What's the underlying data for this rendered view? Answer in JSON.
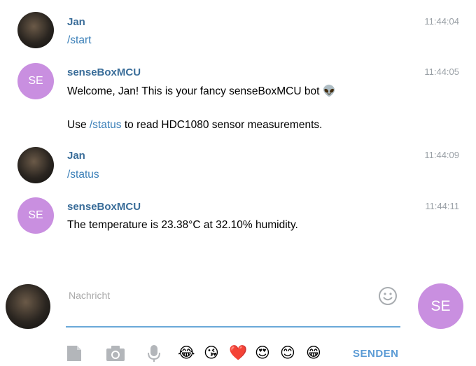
{
  "messages": [
    {
      "sender": "Jan",
      "time": "11:44:04",
      "avatar": "photo",
      "lines": [
        {
          "parts": [
            {
              "text": "/start",
              "cmd": true
            }
          ]
        }
      ]
    },
    {
      "sender": "senseBoxMCU",
      "time": "11:44:05",
      "avatar": "SE",
      "lines": [
        {
          "parts": [
            {
              "text": "Welcome, Jan! This is your fancy senseBoxMCU bot "
            },
            {
              "text": "👽"
            }
          ]
        },
        {
          "parts": [
            {
              "text": "Use "
            },
            {
              "text": "/status",
              "cmd": true
            },
            {
              "text": " to read HDC1080 sensor measurements."
            }
          ]
        }
      ]
    },
    {
      "sender": "Jan",
      "time": "11:44:09",
      "avatar": "photo",
      "lines": [
        {
          "parts": [
            {
              "text": "/status",
              "cmd": true
            }
          ]
        }
      ]
    },
    {
      "sender": "senseBoxMCU",
      "time": "11:44:11",
      "avatar": "SE",
      "lines": [
        {
          "parts": [
            {
              "text": "The temperature is 23.38°C at 32.10% humidity."
            }
          ]
        }
      ]
    }
  ],
  "composer": {
    "placeholder": "Nachricht",
    "bot_initials": "SE",
    "send_label": "SENDEN",
    "emojis": [
      "😂",
      "😘",
      "❤️",
      "😍",
      "😊",
      "😁"
    ]
  },
  "colors": {
    "accent": "#3a6d99",
    "link": "#3a7fb8",
    "bot_avatar": "#c98fe0",
    "send": "#5b9bd5"
  }
}
